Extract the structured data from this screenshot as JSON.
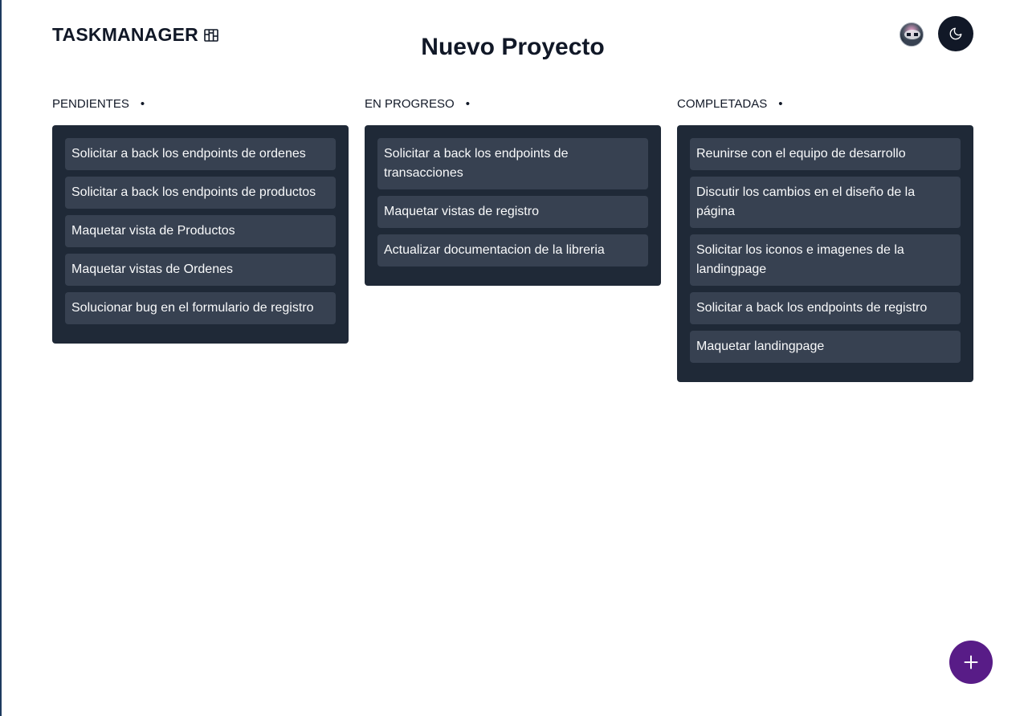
{
  "header": {
    "logo_text": "TASKMANAGER",
    "logo_icon": "kanban-board-icon",
    "page_title": "Nuevo Proyecto",
    "avatar_icon": "user-avatar",
    "theme_toggle_icon": "moon-icon"
  },
  "columns": [
    {
      "title": "PENDIENTES",
      "dot": "•",
      "cards": [
        "Solicitar a back los endpoints de ordenes",
        "Solicitar a back los endpoints de productos",
        "Maquetar vista de Productos",
        "Maquetar vistas de Ordenes",
        "Solucionar bug en el formulario de registro"
      ]
    },
    {
      "title": "EN PROGRESO",
      "dot": "•",
      "cards": [
        "Solicitar a back los endpoints de transacciones",
        "Maquetar vistas de registro",
        "Actualizar documentacion de la libreria"
      ]
    },
    {
      "title": "COMPLETADAS",
      "dot": "•",
      "cards": [
        "Reunirse con el equipo de desarrollo",
        "Discutir los cambios en el diseño de la página",
        "Solicitar los iconos e imagenes de la landingpage",
        "Solicitar a back los endpoints de registro",
        "Maquetar landingpage"
      ]
    }
  ],
  "fab": {
    "icon": "plus-icon",
    "color": "#581c87"
  },
  "colors": {
    "column_bg": "#1f2937",
    "card_bg": "#374151",
    "toggle_bg": "#111827"
  }
}
